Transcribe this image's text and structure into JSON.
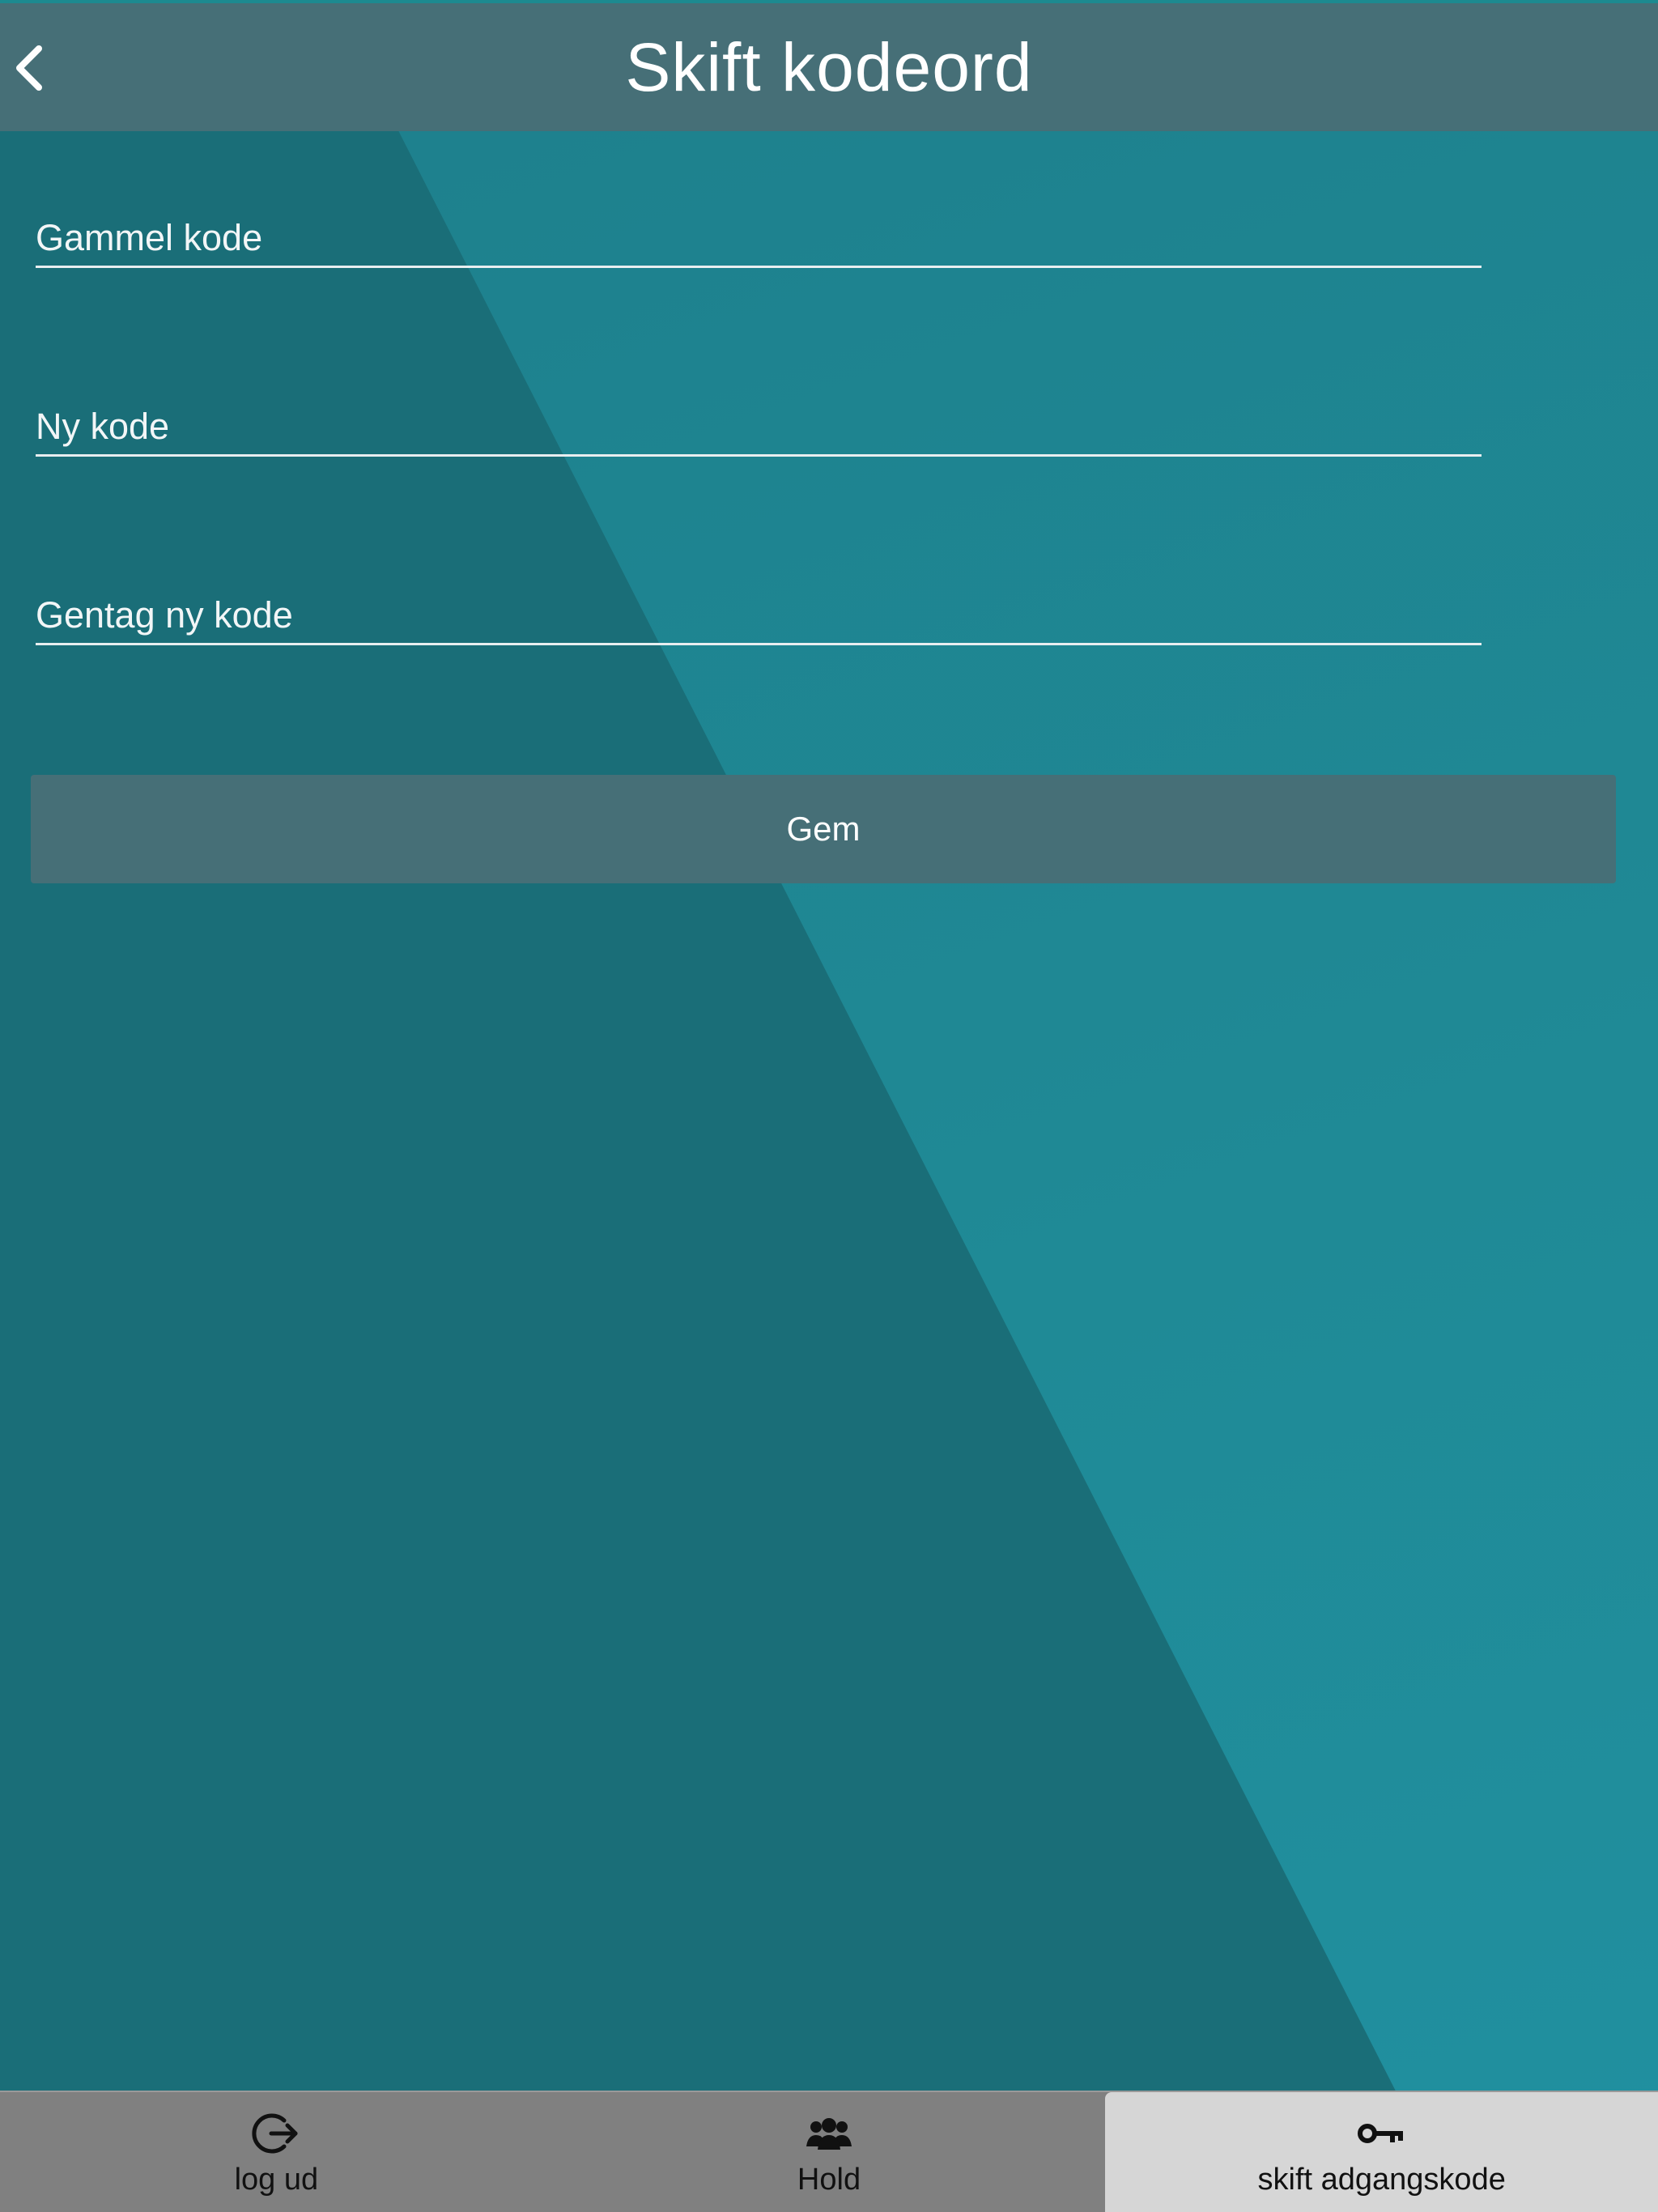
{
  "header": {
    "title": "Skift kodeord",
    "back_icon": "chevron-left-icon"
  },
  "form": {
    "old_password_placeholder": "Gammel kode",
    "new_password_placeholder": "Ny kode",
    "repeat_password_placeholder": "Gentag ny kode",
    "save_label": "Gem"
  },
  "tabbar": {
    "items": [
      {
        "label": "log ud",
        "icon": "logout-icon",
        "active": false
      },
      {
        "label": "Hold",
        "icon": "people-icon",
        "active": false
      },
      {
        "label": "skift adgangskode",
        "icon": "key-icon",
        "active": true
      }
    ]
  },
  "colors": {
    "header": "#466f77",
    "background_dark": "#1a6e78",
    "background_light": "#1f8a96",
    "tabbar": "#808080",
    "tab_active": "#d6d6d6"
  }
}
